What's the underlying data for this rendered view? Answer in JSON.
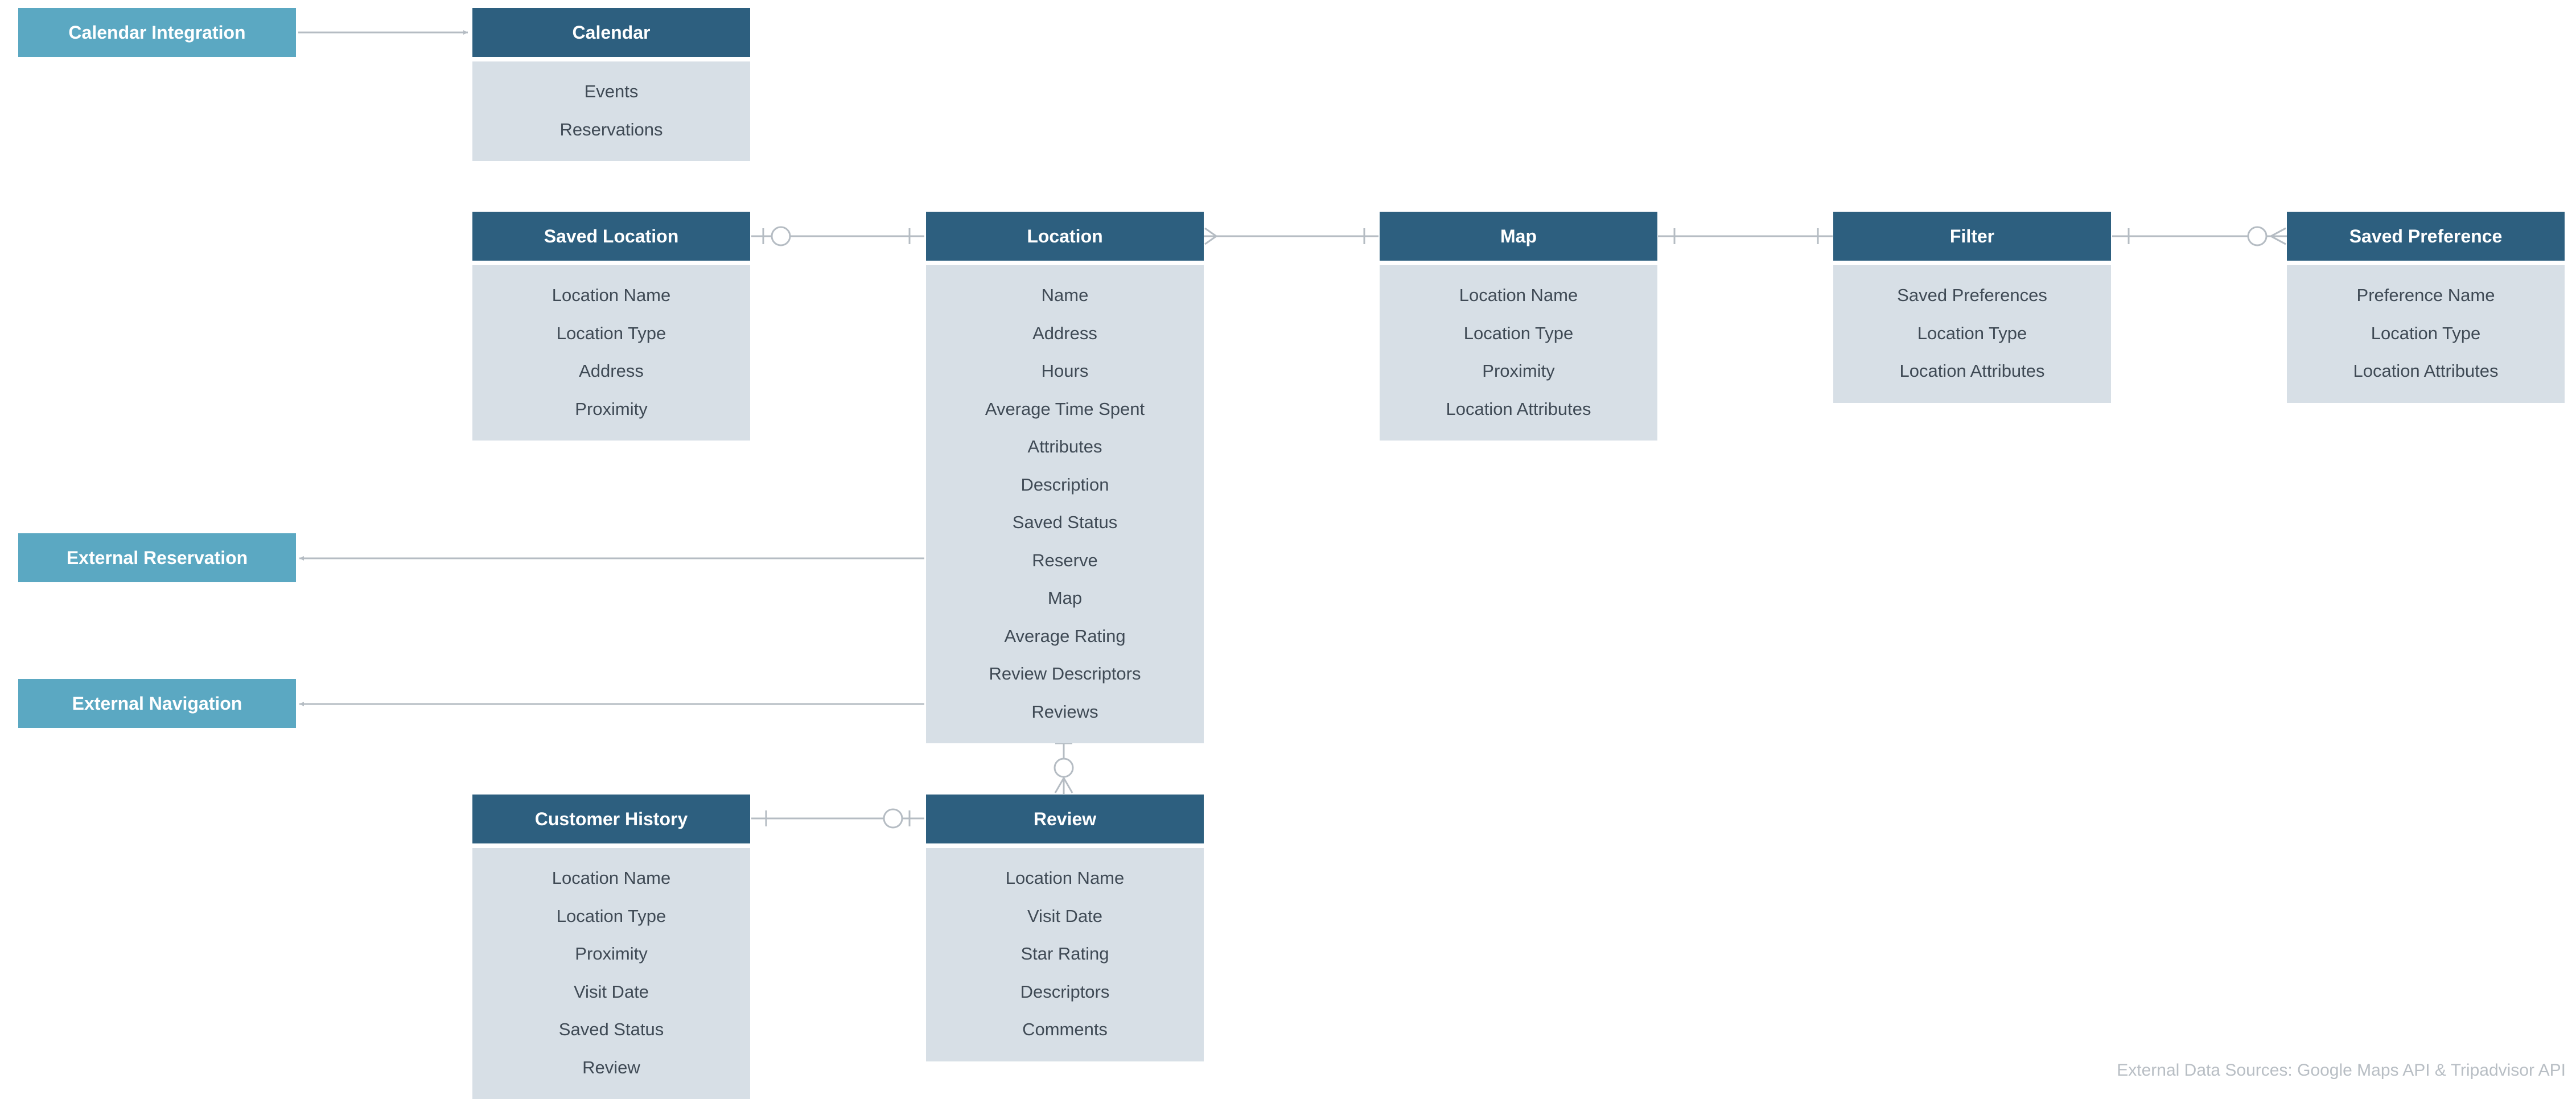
{
  "colors": {
    "entity_header": "#2d5f7f",
    "entity_body": "#d7dfe6",
    "external_box": "#5ba8c2",
    "connector": "#b5bcc3",
    "field_text": "#3f4a55",
    "footnote_text": "#b8bec4"
  },
  "entities": {
    "calendar": {
      "title": "Calendar",
      "fields": [
        "Events",
        "Reservations"
      ]
    },
    "saved_location": {
      "title": "Saved Location",
      "fields": [
        "Location Name",
        "Location Type",
        "Address",
        "Proximity"
      ]
    },
    "location": {
      "title": "Location",
      "fields": [
        "Name",
        "Address",
        "Hours",
        "Average Time Spent",
        "Attributes",
        "Description",
        "Saved Status",
        "Reserve",
        "Map",
        "Average Rating",
        "Review Descriptors",
        "Reviews"
      ]
    },
    "map": {
      "title": "Map",
      "fields": [
        "Location Name",
        "Location Type",
        "Proximity",
        "Location Attributes"
      ]
    },
    "filter": {
      "title": "Filter",
      "fields": [
        "Saved Preferences",
        "Location Type",
        "Location Attributes"
      ]
    },
    "saved_preference": {
      "title": "Saved Preference",
      "fields": [
        "Preference Name",
        "Location Type",
        "Location Attributes"
      ]
    },
    "customer_history": {
      "title": "Customer History",
      "fields": [
        "Location Name",
        "Location Type",
        "Proximity",
        "Visit Date",
        "Saved Status",
        "Review"
      ]
    },
    "review": {
      "title": "Review",
      "fields": [
        "Location Name",
        "Visit Date",
        "Star Rating",
        "Descriptors",
        "Comments"
      ]
    }
  },
  "external": {
    "calendar_integration": "Calendar Integration",
    "external_reservation": "External Reservation",
    "external_navigation": "External Navigation"
  },
  "footnote": "External Data Sources: Google Maps API & Tripadvisor API"
}
